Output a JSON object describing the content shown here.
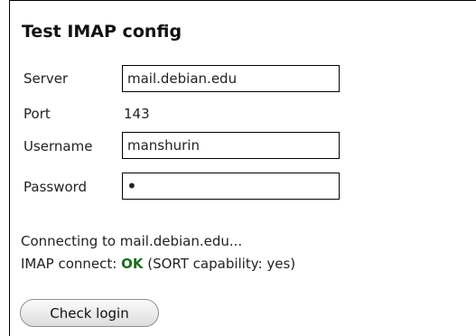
{
  "form": {
    "title": "Test IMAP config",
    "server_label": "Server",
    "server_value": "mail.debian.edu",
    "port_label": "Port",
    "port_value": "143",
    "username_label": "Username",
    "username_value": "manshurin",
    "password_label": "Password",
    "password_mask": "•"
  },
  "status": {
    "connecting": "Connecting to mail.debian.edu...",
    "imap_prefix": "IMAP connect:",
    "imap_result": "OK",
    "imap_detail": "(SORT capability: yes)"
  },
  "actions": {
    "check_login_label": "Check login"
  },
  "colors": {
    "ok": "#1b6e1b"
  }
}
